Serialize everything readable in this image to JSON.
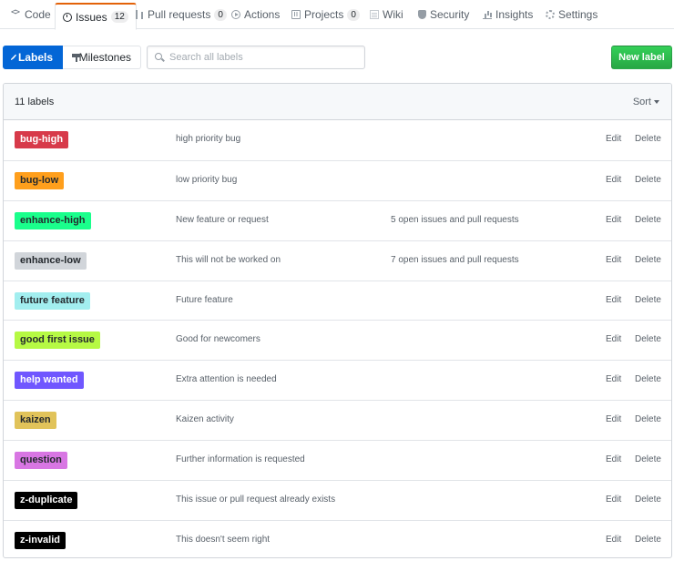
{
  "nav": {
    "tabs": [
      {
        "label": "Code",
        "icon": "code-icon"
      },
      {
        "label": "Issues",
        "icon": "issue-opened-icon",
        "count": "12",
        "selected": true
      },
      {
        "label": "Pull requests",
        "icon": "git-pull-request-icon",
        "count": "0"
      },
      {
        "label": "Actions",
        "icon": "play-icon"
      },
      {
        "label": "Projects",
        "icon": "project-icon",
        "count": "0"
      },
      {
        "label": "Wiki",
        "icon": "book-icon"
      },
      {
        "label": "Security",
        "icon": "shield-icon"
      },
      {
        "label": "Insights",
        "icon": "graph-icon"
      },
      {
        "label": "Settings",
        "icon": "gear-icon"
      }
    ]
  },
  "subnav": {
    "labels": "Labels",
    "milestones": "Milestones"
  },
  "search": {
    "placeholder": "Search all labels",
    "value": ""
  },
  "actions": {
    "new_label": "New label"
  },
  "list": {
    "count": "11 labels",
    "sort": "Sort",
    "edit": "Edit",
    "delete": "Delete",
    "labels": [
      {
        "name": "bug-high",
        "color": "#d73a4a",
        "text_color": "#ffffff",
        "description": "high priority bug",
        "issues": ""
      },
      {
        "name": "bug-low",
        "color": "#ff9f1c",
        "text_color": "#24292e",
        "description": "low priority bug",
        "issues": ""
      },
      {
        "name": "enhance-high",
        "color": "#1aff8c",
        "text_color": "#24292e",
        "description": "New feature or request",
        "issues": "5 open issues and pull requests"
      },
      {
        "name": "enhance-low",
        "color": "#d1d5da",
        "text_color": "#24292e",
        "description": "This will not be worked on",
        "issues": "7 open issues and pull requests"
      },
      {
        "name": "future feature",
        "color": "#a2eeef",
        "text_color": "#24292e",
        "description": "Future feature",
        "issues": ""
      },
      {
        "name": "good first issue",
        "color": "#b6f944",
        "text_color": "#24292e",
        "description": "Good for newcomers",
        "issues": ""
      },
      {
        "name": "help wanted",
        "color": "#7057ff",
        "text_color": "#ffffff",
        "description": "Extra attention is needed",
        "issues": ""
      },
      {
        "name": "kaizen",
        "color": "#e1c35a",
        "text_color": "#24292e",
        "description": "Kaizen activity",
        "issues": ""
      },
      {
        "name": "question",
        "color": "#d876e3",
        "text_color": "#24292e",
        "description": "Further information is requested",
        "issues": ""
      },
      {
        "name": "z-duplicate",
        "color": "#000000",
        "text_color": "#ffffff",
        "description": "This issue or pull request already exists",
        "issues": ""
      },
      {
        "name": "z-invalid",
        "color": "#000000",
        "text_color": "#ffffff",
        "description": "This doesn't seem right",
        "issues": ""
      }
    ]
  }
}
